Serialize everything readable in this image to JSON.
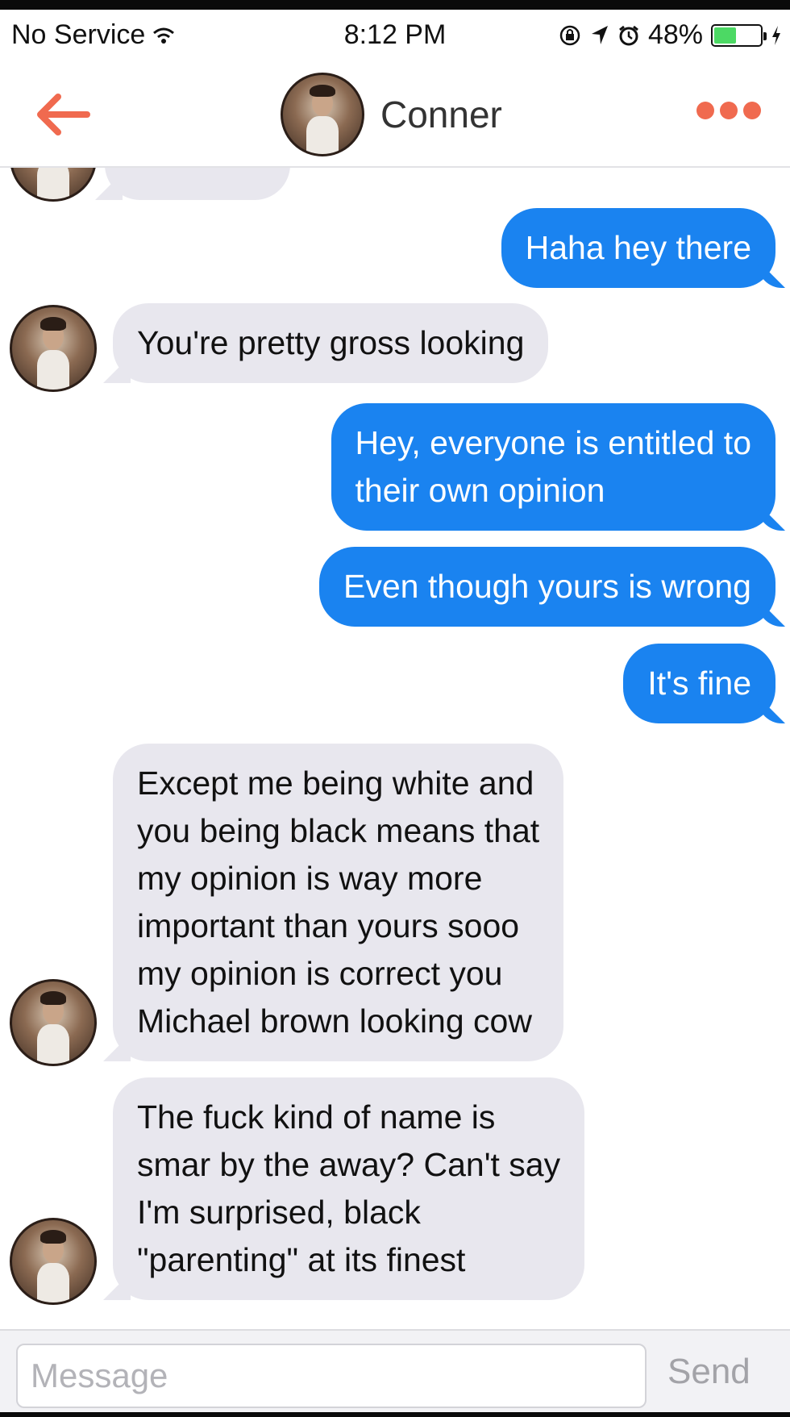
{
  "status_bar": {
    "carrier": "No Service",
    "time": "8:12 PM",
    "battery_percent": "48%",
    "battery_level": 0.48,
    "icons": [
      "wifi-icon",
      "rotation-lock-icon",
      "location-icon",
      "alarm-icon",
      "battery-icon",
      "charging-icon"
    ]
  },
  "nav": {
    "title": "Conner",
    "back_icon": "back-arrow-icon",
    "more_icon": "more-options-icon",
    "accent_color": "#f06a4f"
  },
  "messages": [
    {
      "sender": "me",
      "text": "Haha hey there"
    },
    {
      "sender": "them",
      "text": "You're pretty gross looking"
    },
    {
      "sender": "me",
      "text": "Hey, everyone is entitled to\ntheir own opinion"
    },
    {
      "sender": "me",
      "text": "Even though yours is wrong"
    },
    {
      "sender": "me",
      "text": "It's fine"
    },
    {
      "sender": "them",
      "text": "Except me being white and\nyou being black means that\nmy opinion is way more\nimportant than yours sooo\nmy opinion is correct you\nMichael brown looking cow"
    },
    {
      "sender": "them",
      "text": "The fuck kind of name is\nsmar by the away? Can't say\nI'm surprised, black\n\"parenting\" at its finest"
    }
  ],
  "composer": {
    "placeholder": "Message",
    "value": "",
    "send_label": "Send"
  },
  "colors": {
    "outgoing_bubble": "#1a83f0",
    "incoming_bubble": "#e8e7ee"
  }
}
